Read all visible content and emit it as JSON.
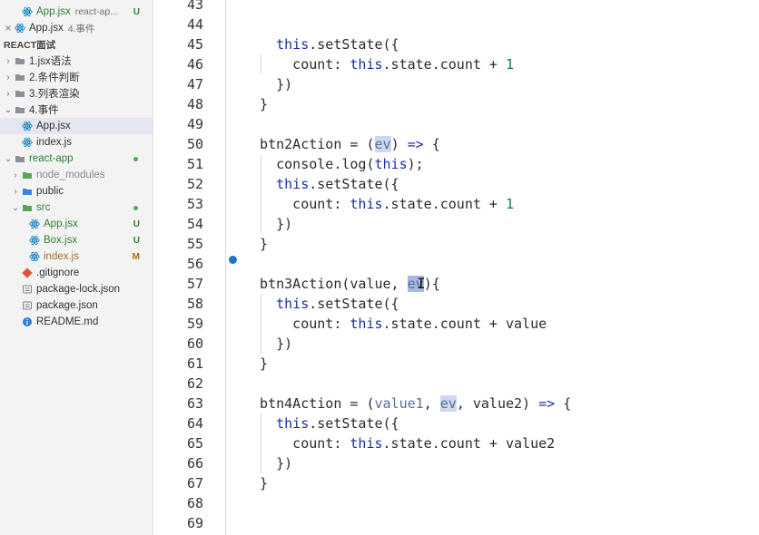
{
  "sidebar": {
    "rows": [
      {
        "kind": "file",
        "indent": 1,
        "icon": "react-icon",
        "label": "App.jsx",
        "sub": "react-ap...",
        "badge": "U",
        "color": "#2e7d32"
      },
      {
        "kind": "open",
        "indent": 0,
        "icon": "react-icon",
        "label": "App.jsx",
        "sub": "4.事件",
        "color": "#333333"
      },
      {
        "kind": "section",
        "label": "REACT面试"
      },
      {
        "kind": "folder",
        "indent": 0,
        "chev": "›",
        "label": "1.jsx语法",
        "color": "#333333"
      },
      {
        "kind": "folder",
        "indent": 0,
        "chev": "›",
        "label": "2.条件判断",
        "color": "#333333"
      },
      {
        "kind": "folder",
        "indent": 0,
        "chev": "›",
        "label": "3.列表渲染",
        "color": "#333333"
      },
      {
        "kind": "folder",
        "indent": 0,
        "chev": "⌄",
        "label": "4.事件",
        "color": "#333333"
      },
      {
        "kind": "file",
        "indent": 1,
        "icon": "react-icon",
        "label": "App.jsx",
        "color": "#333333",
        "active": true
      },
      {
        "kind": "file",
        "indent": 1,
        "icon": "react-icon",
        "label": "index.js",
        "color": "#333333"
      },
      {
        "kind": "folder",
        "indent": 0,
        "chev": "⌄",
        "label": "react-app",
        "color": "#2e7d32",
        "dot": "#4caf50"
      },
      {
        "kind": "folder",
        "indent": 1,
        "chev": "›",
        "label": "node_modules",
        "color": "#8a8a8a",
        "icon": "green-folder-icon"
      },
      {
        "kind": "folder",
        "indent": 1,
        "chev": "›",
        "label": "public",
        "color": "#333333",
        "icon": "blue-folder-icon"
      },
      {
        "kind": "folder",
        "indent": 1,
        "chev": "⌄",
        "label": "src",
        "color": "#2e7d32",
        "icon": "green-folder-icon",
        "dot": "#4caf50"
      },
      {
        "kind": "file",
        "indent": 2,
        "icon": "react-icon",
        "label": "App.jsx",
        "badge": "U",
        "color": "#2e7d32"
      },
      {
        "kind": "file",
        "indent": 2,
        "icon": "react-icon",
        "label": "Box.jsx",
        "badge": "U",
        "color": "#2e7d32"
      },
      {
        "kind": "file",
        "indent": 2,
        "icon": "react-icon",
        "label": "index.js",
        "badge": "M",
        "color": "#a0721a"
      },
      {
        "kind": "file",
        "indent": 1,
        "icon": "git-icon",
        "label": ".gitignore",
        "color": "#333333"
      },
      {
        "kind": "file",
        "indent": 1,
        "icon": "npm-icon",
        "label": "package-lock.json",
        "color": "#333333"
      },
      {
        "kind": "file",
        "indent": 1,
        "icon": "npm-icon",
        "label": "package.json",
        "color": "#333333"
      },
      {
        "kind": "file",
        "indent": 1,
        "icon": "info-icon",
        "label": "README.md",
        "color": "#333333"
      }
    ]
  },
  "editor": {
    "lines": [
      {
        "n": "43",
        "t": []
      },
      {
        "n": "44",
        "t": []
      },
      {
        "n": "45",
        "t": [
          [
            "    ",
            ""
          ],
          [
            "this",
            "kw"
          ],
          [
            ".setState({",
            ""
          ]
        ]
      },
      {
        "n": "46",
        "t": [
          [
            "      count: ",
            ""
          ],
          [
            "this",
            "kw"
          ],
          [
            ".state.count + ",
            ""
          ],
          [
            "1",
            "num"
          ]
        ]
      },
      {
        "n": "47",
        "t": [
          [
            "    })",
            ""
          ]
        ]
      },
      {
        "n": "48",
        "t": [
          [
            "  }",
            ""
          ]
        ]
      },
      {
        "n": "49",
        "t": []
      },
      {
        "n": "50",
        "t": [
          [
            "  btn2Action = (",
            ""
          ],
          [
            "ev",
            "par hl"
          ],
          [
            ") ",
            ""
          ],
          [
            "=>",
            "kw"
          ],
          [
            " {",
            ""
          ]
        ]
      },
      {
        "n": "51",
        "t": [
          [
            "    console.log(",
            ""
          ],
          [
            "this",
            "kw"
          ],
          [
            ");",
            ""
          ]
        ]
      },
      {
        "n": "52",
        "t": [
          [
            "    ",
            ""
          ],
          [
            "this",
            "kw"
          ],
          [
            ".setState({",
            ""
          ]
        ]
      },
      {
        "n": "53",
        "t": [
          [
            "      count: ",
            ""
          ],
          [
            "this",
            "kw"
          ],
          [
            ".state.count + ",
            ""
          ],
          [
            "1",
            "num"
          ]
        ]
      },
      {
        "n": "54",
        "t": [
          [
            "    })",
            ""
          ]
        ]
      },
      {
        "n": "55",
        "t": [
          [
            "  }",
            ""
          ]
        ]
      },
      {
        "n": "56",
        "t": []
      },
      {
        "n": "57",
        "t": [
          [
            "  btn3Action(value, ",
            ""
          ],
          [
            "ev",
            "par sel"
          ],
          [
            "){",
            ""
          ]
        ]
      },
      {
        "n": "58",
        "t": [
          [
            "    ",
            ""
          ],
          [
            "this",
            "kw"
          ],
          [
            ".setState({",
            ""
          ]
        ]
      },
      {
        "n": "59",
        "t": [
          [
            "      count: ",
            ""
          ],
          [
            "this",
            "kw"
          ],
          [
            ".state.count + value",
            ""
          ]
        ]
      },
      {
        "n": "60",
        "t": [
          [
            "    })",
            ""
          ]
        ]
      },
      {
        "n": "61",
        "t": [
          [
            "  }",
            ""
          ]
        ]
      },
      {
        "n": "62",
        "t": []
      },
      {
        "n": "63",
        "t": [
          [
            "  btn4Action = (",
            ""
          ],
          [
            "value1",
            "par"
          ],
          [
            ", ",
            ""
          ],
          [
            "ev",
            "par hl"
          ],
          [
            ", value2) ",
            ""
          ],
          [
            "=>",
            "kw"
          ],
          [
            " {",
            ""
          ]
        ]
      },
      {
        "n": "64",
        "t": [
          [
            "    ",
            ""
          ],
          [
            "this",
            "kw"
          ],
          [
            ".setState({",
            ""
          ]
        ]
      },
      {
        "n": "65",
        "t": [
          [
            "      count: ",
            ""
          ],
          [
            "this",
            "kw"
          ],
          [
            ".state.count + value2",
            ""
          ]
        ]
      },
      {
        "n": "66",
        "t": [
          [
            "    })",
            ""
          ]
        ]
      },
      {
        "n": "67",
        "t": [
          [
            "  }",
            ""
          ]
        ]
      },
      {
        "n": "68",
        "t": []
      },
      {
        "n": "69",
        "t": []
      }
    ]
  }
}
